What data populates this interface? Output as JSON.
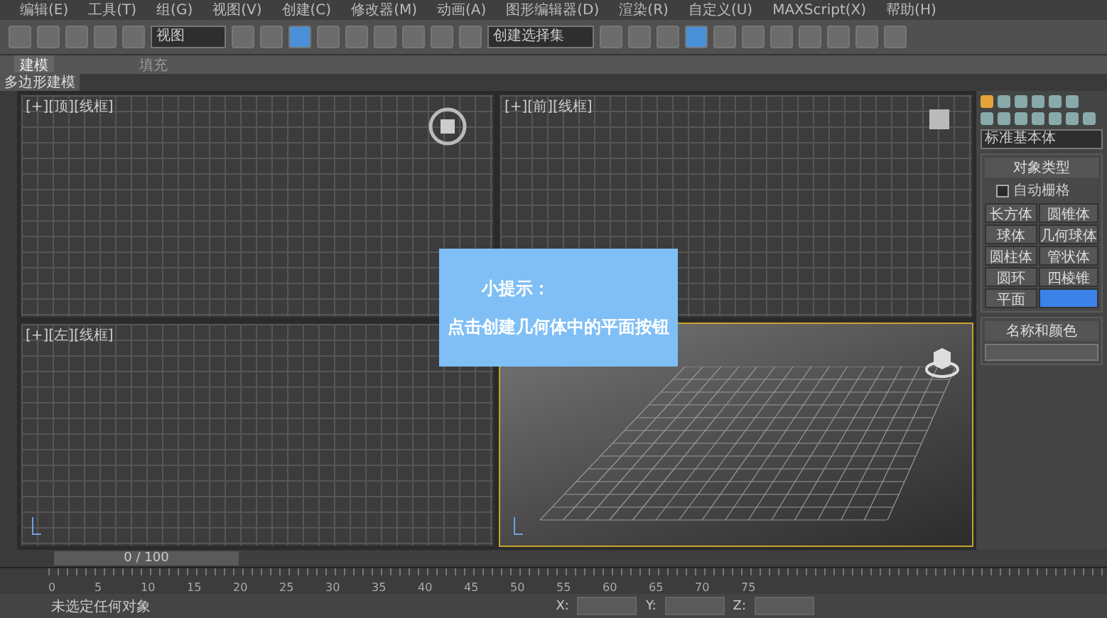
{
  "menu": [
    "编辑(E)",
    "工具(T)",
    "组(G)",
    "视图(V)",
    "创建(C)",
    "修改器(M)",
    "动画(A)",
    "图形编辑器(D)",
    "渲染(R)",
    "自定义(U)",
    "MAXScript(X)",
    "帮助(H)"
  ],
  "toolbar": {
    "view_dropdown": "视图",
    "selection_set": "创建选择集"
  },
  "ribbon_tabs": [
    {
      "label": "建模",
      "selected": true
    },
    {
      "label": "填充",
      "selected": false
    }
  ],
  "ribbon_panel": "多边形建模",
  "viewports": [
    {
      "label": "[+][顶][线框]",
      "kind": "grid",
      "active": false
    },
    {
      "label": "[+][前][线框]",
      "kind": "grid",
      "active": false
    },
    {
      "label": "[+][左][线框]",
      "kind": "grid",
      "active": false
    },
    {
      "kind": "perspective",
      "active": true
    }
  ],
  "command_panel": {
    "category": "标准基本体",
    "object_type": {
      "title": "对象类型",
      "autogrid": {
        "label": "自动栅格",
        "checked": false
      },
      "buttons": [
        {
          "label": "长方体",
          "selected": false
        },
        {
          "label": "圆锥体",
          "selected": false
        },
        {
          "label": "球体",
          "selected": false
        },
        {
          "label": "几何球体",
          "selected": false
        },
        {
          "label": "圆柱体",
          "selected": false
        },
        {
          "label": "管状体",
          "selected": false
        },
        {
          "label": "圆环",
          "selected": false
        },
        {
          "label": "四棱锥",
          "selected": false
        },
        {
          "label": "平面",
          "selected": false
        },
        {
          "selected": true
        }
      ]
    },
    "name_color": {
      "title": "名称和颜色"
    }
  },
  "timeline": {
    "frame": "0 / 100",
    "level": 0,
    "ticks": [
      "0",
      "5",
      "10",
      "15",
      "20",
      "25",
      "30",
      "35",
      "40",
      "45",
      "50",
      "55",
      "60",
      "65",
      "70",
      "75"
    ]
  },
  "status": {
    "message": "未选定任何对象",
    "coords": [
      "X:",
      "Y:",
      "Z:"
    ]
  },
  "tip": {
    "title": "小提示：",
    "text": "点击创建几何体中的平面按钮"
  }
}
